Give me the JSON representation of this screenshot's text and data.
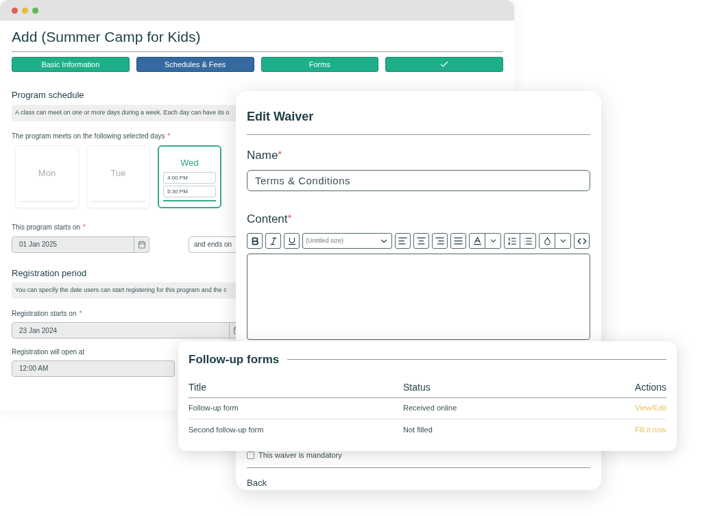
{
  "window": {
    "title": "Add (Summer Camp for Kids)"
  },
  "steps": [
    {
      "kind": "text",
      "label": "Basic Information",
      "selected": false
    },
    {
      "kind": "text",
      "label": "Schedules & Fees",
      "selected": true
    },
    {
      "kind": "text",
      "label": "Forms",
      "selected": false
    },
    {
      "kind": "check",
      "selected": false
    }
  ],
  "schedule": {
    "heading": "Program schedule",
    "info": "A class can meet on one or more days during a week. Each day can have its o",
    "days_label": {
      "text": "The program meets on the following selected days",
      "mark": "*"
    },
    "days": [
      {
        "label": "Mon",
        "selected": false
      },
      {
        "label": "Tue",
        "selected": false
      },
      {
        "label": "Wed",
        "selected": true,
        "times": [
          "4:00 PM",
          "5:30 PM"
        ]
      }
    ],
    "starts": {
      "label": "This program starts on",
      "mark": "*",
      "value": "01 Jan 2025"
    },
    "ends": {
      "label": "and ends on"
    }
  },
  "registration": {
    "heading": "Registration period",
    "info": "You can specify the date users can start registering for this program and the c",
    "starts": {
      "label": "Registration starts on",
      "mark": "*",
      "value": "23 Jan 2024"
    },
    "opens": {
      "label": "Registration will open at",
      "value": "12:00 AM"
    }
  },
  "modal": {
    "title": "Edit Waiver",
    "name": {
      "label": "Name",
      "mark": "*",
      "value": "Terms & Conditions"
    },
    "content": {
      "label": "Content",
      "mark": "*",
      "size": "(Untitled size)"
    },
    "mandatory": {
      "label": "This waiver is mandatory",
      "checked": false
    },
    "back": "Back"
  },
  "followup": {
    "title": "Follow-up forms",
    "columns": [
      "Title",
      "Status",
      "Actions"
    ],
    "rows": [
      {
        "title": "Follow-up form",
        "status": "Received online",
        "action": "View/Edit"
      },
      {
        "title": "Second follow-up form",
        "status": "Not filled",
        "action": "Fill it now"
      }
    ]
  }
}
